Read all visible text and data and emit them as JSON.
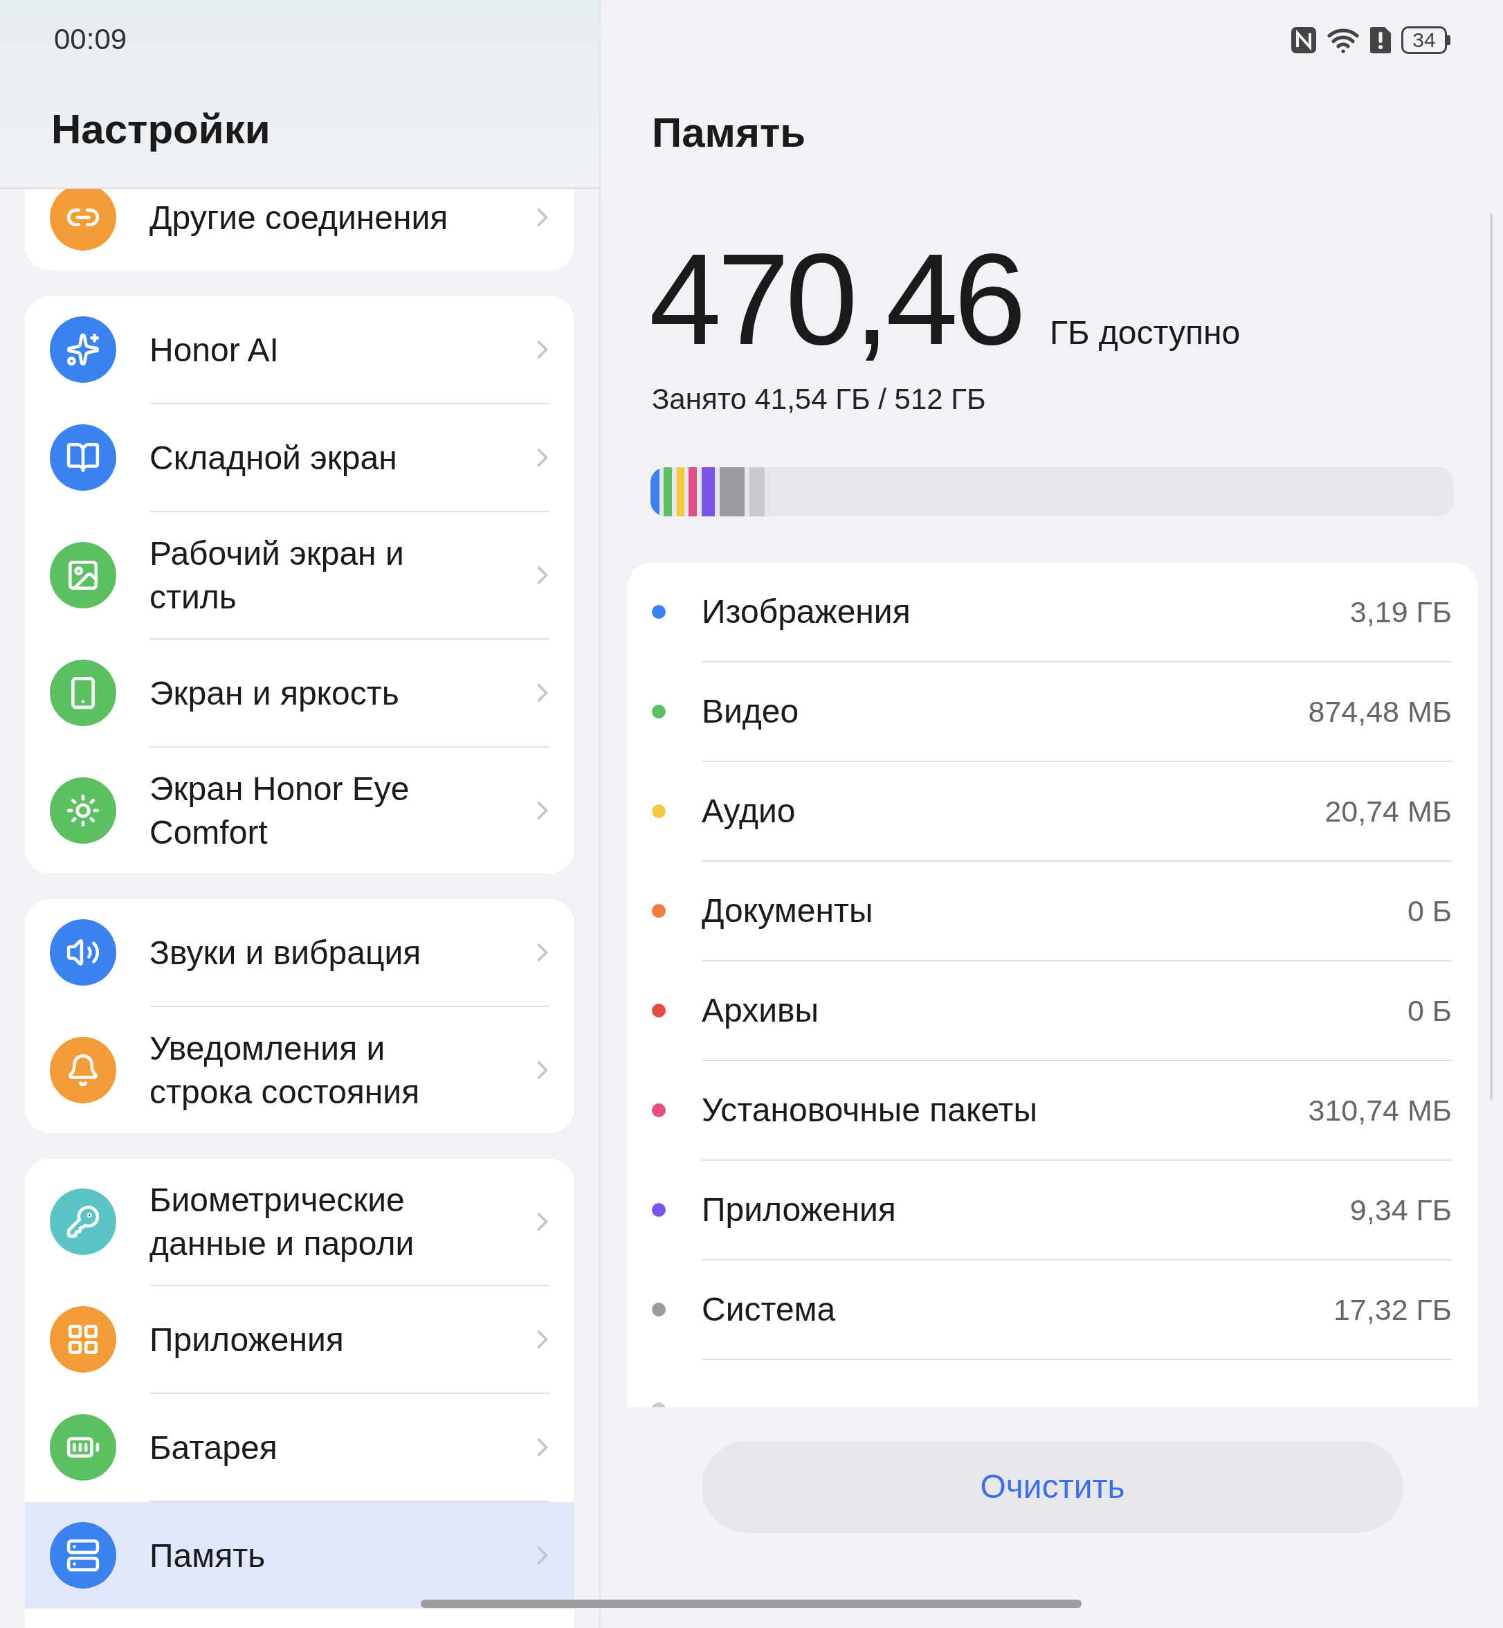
{
  "status_bar": {
    "time": "00:09",
    "battery": "34"
  },
  "sidebar": {
    "title": "Настройки",
    "groups": [
      {
        "items": [
          {
            "label": "Другие соединения",
            "kind": "link",
            "color": "#f29c38",
            "selected": false
          }
        ]
      },
      {
        "items": [
          {
            "label": "Honor AI",
            "kind": "sparkle",
            "color": "#3b82ee",
            "selected": false
          },
          {
            "label": "Складной экран",
            "kind": "fold",
            "color": "#3b82ee",
            "selected": false
          },
          {
            "label": "Рабочий экран и стиль",
            "kind": "image",
            "color": "#5cbf62",
            "selected": false
          },
          {
            "label": "Экран и яркость",
            "kind": "phone",
            "color": "#5cbf62",
            "selected": false
          },
          {
            "label": "Экран Honor Eye Comfort",
            "kind": "eye",
            "color": "#5cbf62",
            "selected": false
          }
        ]
      },
      {
        "items": [
          {
            "label": "Звуки и вибрация",
            "kind": "sound",
            "color": "#3b82ee",
            "selected": false
          },
          {
            "label": "Уведомления и строка состояния",
            "kind": "bell",
            "color": "#f29c38",
            "selected": false
          }
        ]
      },
      {
        "items": [
          {
            "label": "Биометрические данные и пароли",
            "kind": "key",
            "color": "#5cc4c4",
            "selected": false
          },
          {
            "label": "Приложения",
            "kind": "apps",
            "color": "#f29c38",
            "selected": false
          },
          {
            "label": "Батарея",
            "kind": "battery",
            "color": "#5cbf62",
            "selected": false
          },
          {
            "label": "Память",
            "kind": "storage",
            "color": "#3b82ee",
            "selected": true
          }
        ]
      }
    ]
  },
  "content": {
    "title": "Память",
    "available": {
      "value": "470,46",
      "unit": "ГБ доступно"
    },
    "used": "Занято 41,54 ГБ / 512 ГБ",
    "categories": [
      {
        "name": "Изображения",
        "size": "3,19 ГБ",
        "color": "#3b82ee"
      },
      {
        "name": "Видео",
        "size": "874,48 МБ",
        "color": "#5cbf62"
      },
      {
        "name": "Аудио",
        "size": "20,74 МБ",
        "color": "#f5c842"
      },
      {
        "name": "Документы",
        "size": "0 Б",
        "color": "#ef7a3a"
      },
      {
        "name": "Архивы",
        "size": "0 Б",
        "color": "#e04b3b"
      },
      {
        "name": "Установочные пакеты",
        "size": "310,74 МБ",
        "color": "#e24e86"
      },
      {
        "name": "Приложения",
        "size": "9,34 ГБ",
        "color": "#7b55e8"
      },
      {
        "name": "Система",
        "size": "17,32 ГБ",
        "color": "#9b9ca0"
      },
      {
        "color": "#c9cacf"
      }
    ],
    "clean_button": "Очистить"
  }
}
